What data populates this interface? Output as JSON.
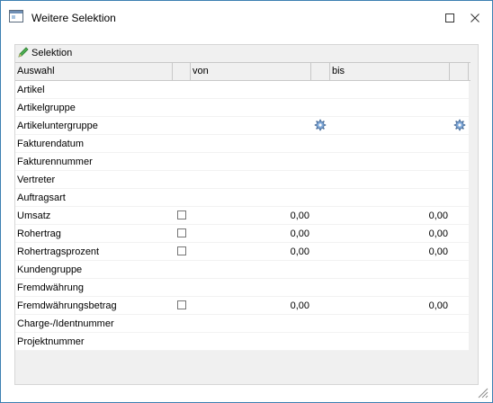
{
  "window": {
    "title": "Weitere Selektion",
    "border_color": "#3c7fb1"
  },
  "panel": {
    "title": "Selektion",
    "icon": "pencil-icon"
  },
  "columns": {
    "auswahl": "Auswahl",
    "von": "von",
    "bis": "bis"
  },
  "rows": [
    {
      "label": "Artikel"
    },
    {
      "label": "Artikelgruppe"
    },
    {
      "label": "Artikeluntergruppe",
      "von_icon": "gear-icon",
      "bis_icon": "gear-icon"
    },
    {
      "label": "Fakturendatum"
    },
    {
      "label": "Fakturennummer"
    },
    {
      "label": "Vertreter"
    },
    {
      "label": "Auftragsart"
    },
    {
      "label": "Umsatz",
      "checkbox": true,
      "von": "0,00",
      "bis": "0,00"
    },
    {
      "label": "Rohertrag",
      "checkbox": true,
      "von": "0,00",
      "bis": "0,00"
    },
    {
      "label": "Rohertragsprozent",
      "checkbox": true,
      "von": "0,00",
      "bis": "0,00"
    },
    {
      "label": "Kundengruppe"
    },
    {
      "label": "Fremdwährung"
    },
    {
      "label": "Fremdwährungsbetrag",
      "checkbox": true,
      "von": "0,00",
      "bis": "0,00"
    },
    {
      "label": "Charge-/Identnummer"
    },
    {
      "label": "Projektnummer"
    }
  ]
}
